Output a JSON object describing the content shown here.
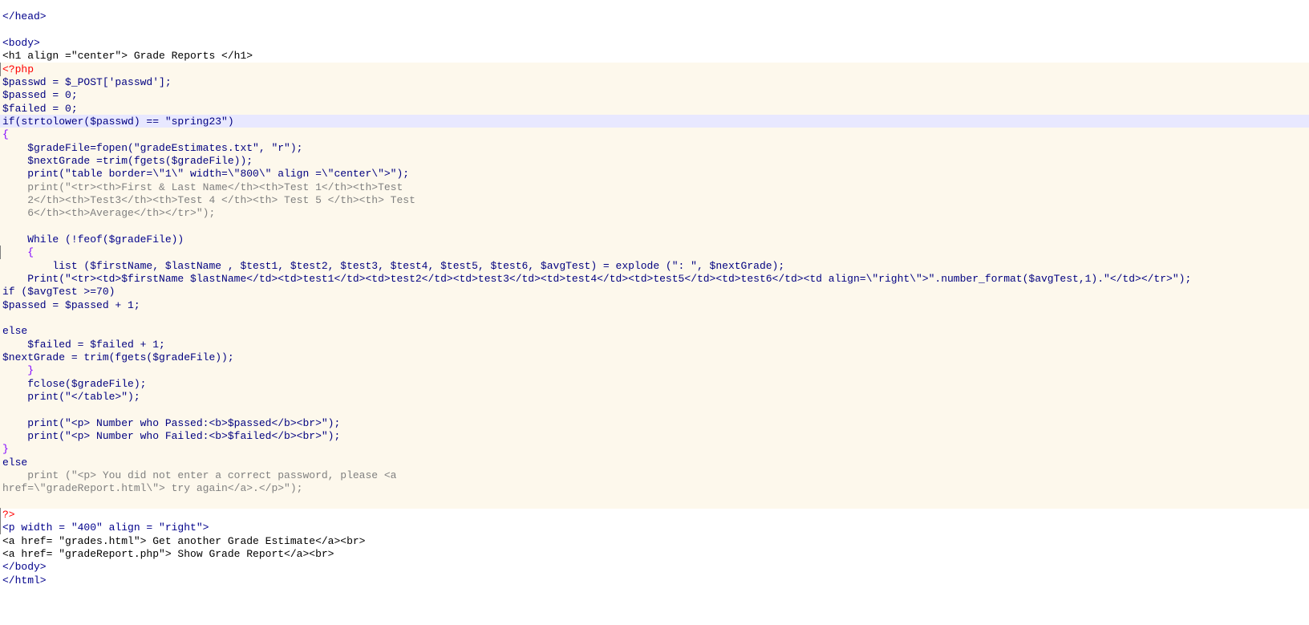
{
  "editor": {
    "lines": [
      "</head>",
      "",
      "<body>",
      "<h1 align =\"center\"> Grade Reports </h1>",
      "<?php",
      "$passwd = $_POST['passwd'];",
      "$passed = 0;",
      "$failed = 0;",
      "if(strtolower($passwd) == \"spring23\")",
      "{",
      "    $gradeFile=fopen(\"gradeEstimates.txt\", \"r\");",
      "    $nextGrade =trim(fgets($gradeFile));",
      "    print(\"table border=\\\"1\\\" width=\\\"800\\\" align =\\\"center\\\">\");",
      "    print(\"<tr><th>First & Last Name</th><th>Test 1</th><th>Test",
      "    2</th><th>Test3</th><th>Test 4 </th><th> Test 5 </th><th> Test",
      "    6</th><th>Average</th></tr>\");",
      "",
      "    While (!feof($gradeFile))",
      "    {",
      "        list ($firstName, $lastName , $test1, $test2, $test3, $test4, $test5, $test6, $avgTest) = explode (\": \", $nextGrade);",
      "    Print(\"<tr><td>$firstName $lastName</td><td>test1</td><td>test2</td><td>test3</td><td>test4</td><td>test5</td><td>test6</td><td align=\\\"right\\\">\".number_format($avgTest,1).\"</td></tr>\");",
      "if ($avgTest >=70)",
      "$passed = $passed + 1;",
      "",
      "else",
      "    $failed = $failed + 1;",
      "$nextGrade = trim(fgets($gradeFile));",
      "    }",
      "    fclose($gradeFile);",
      "    print(\"</table>\");",
      "",
      "    print(\"<p> Number who Passed:<b>$passed</b><br>\");",
      "    print(\"<p> Number who Failed:<b>$failed</b><br>\");",
      "}",
      "else",
      "    print (\"<p> You did not enter a correct password, please <a",
      "href=\\\"gradeReport.html\\\"> try again</a>.</p>\");",
      "",
      "?>",
      "<p width = \"400\" align = \"right\">",
      "<a href= \"grades.html\"> Get another Grade Estimate</a><br>",
      "<a href= \"gradeReport.php\"> Show Grade Report</a><br>",
      "</body>",
      "</html>"
    ]
  }
}
